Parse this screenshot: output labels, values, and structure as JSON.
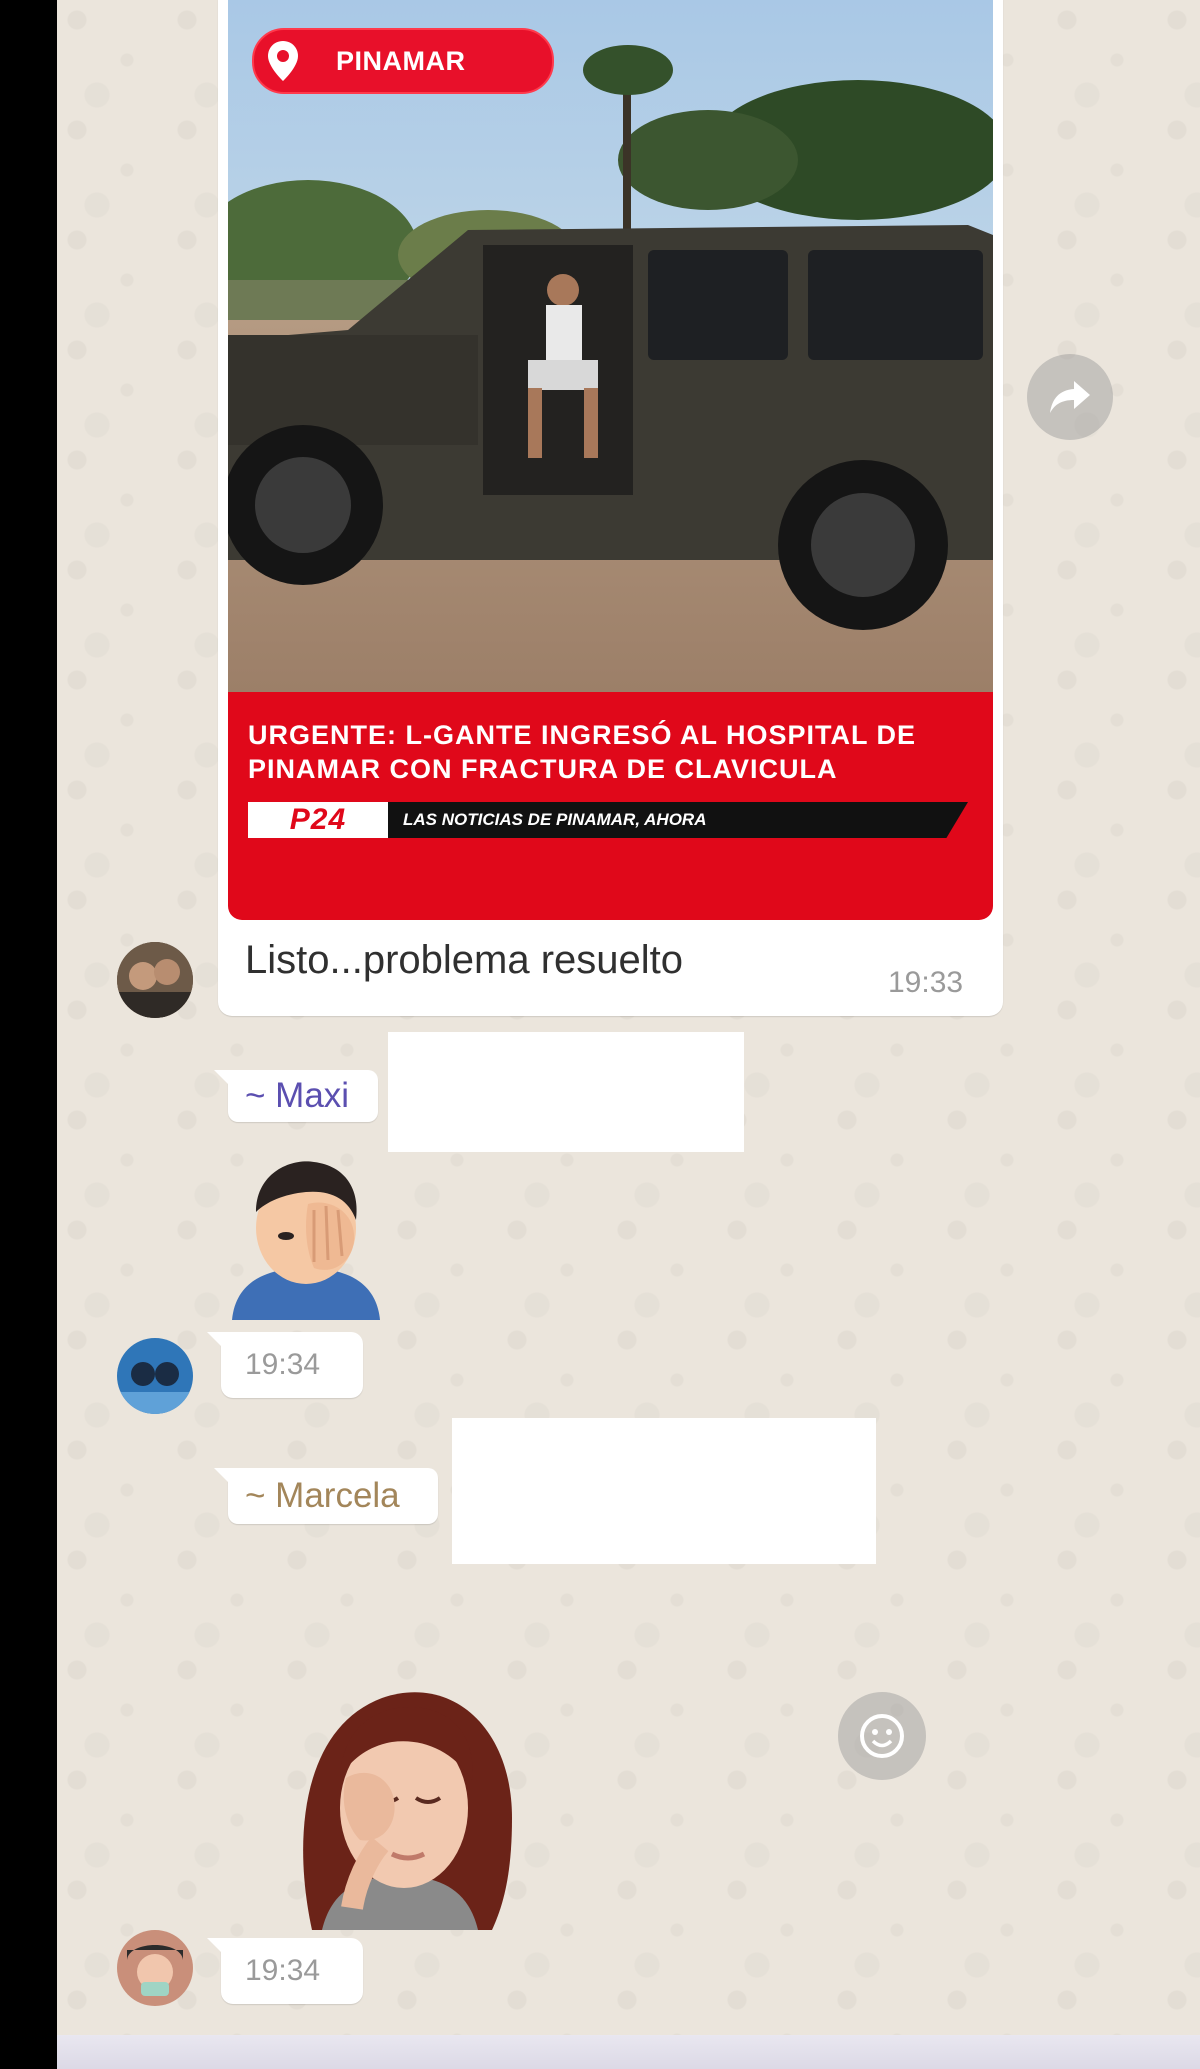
{
  "news_post": {
    "location_label": "PINAMAR",
    "headline_line1": "URGENTE: L-GANTE INGRESÓ AL HOSPITAL DE",
    "headline_line2": "PINAMAR CON FRACTURA DE CLAVICULA",
    "brand_logo": "P24",
    "brand_tagline": "LAS NOTICIAS DE PINAMAR, AHORA",
    "caption": "Listo...problema resuelto",
    "time": "19:33"
  },
  "messages": [
    {
      "sender": "~ Maxi",
      "sender_color": "#5b4fb0",
      "time": "19:34",
      "sticker": "facepalm-man-emoji"
    },
    {
      "sender": "~ Marcela",
      "sender_color": "#a3865a",
      "time": "19:34",
      "sticker": "facepalm-woman-sticker"
    }
  ],
  "icons": {
    "forward": "forward-arrow-icon",
    "sticker_reaction": "sticker-face-icon",
    "location": "location-pin-icon"
  }
}
